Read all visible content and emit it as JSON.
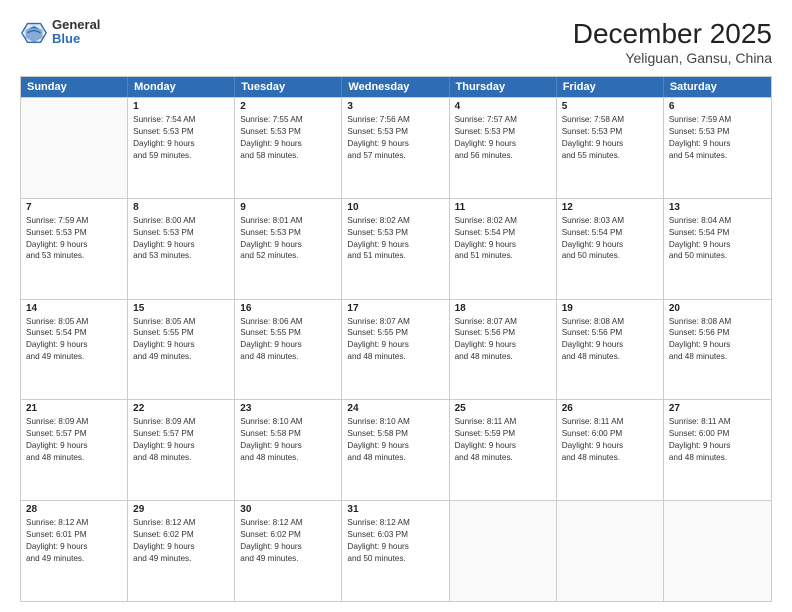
{
  "header": {
    "logo": {
      "general": "General",
      "blue": "Blue"
    },
    "title": "December 2025",
    "location": "Yeliguan, Gansu, China"
  },
  "weekdays": [
    "Sunday",
    "Monday",
    "Tuesday",
    "Wednesday",
    "Thursday",
    "Friday",
    "Saturday"
  ],
  "rows": [
    [
      {
        "day": "",
        "lines": []
      },
      {
        "day": "1",
        "lines": [
          "Sunrise: 7:54 AM",
          "Sunset: 5:53 PM",
          "Daylight: 9 hours",
          "and 59 minutes."
        ]
      },
      {
        "day": "2",
        "lines": [
          "Sunrise: 7:55 AM",
          "Sunset: 5:53 PM",
          "Daylight: 9 hours",
          "and 58 minutes."
        ]
      },
      {
        "day": "3",
        "lines": [
          "Sunrise: 7:56 AM",
          "Sunset: 5:53 PM",
          "Daylight: 9 hours",
          "and 57 minutes."
        ]
      },
      {
        "day": "4",
        "lines": [
          "Sunrise: 7:57 AM",
          "Sunset: 5:53 PM",
          "Daylight: 9 hours",
          "and 56 minutes."
        ]
      },
      {
        "day": "5",
        "lines": [
          "Sunrise: 7:58 AM",
          "Sunset: 5:53 PM",
          "Daylight: 9 hours",
          "and 55 minutes."
        ]
      },
      {
        "day": "6",
        "lines": [
          "Sunrise: 7:59 AM",
          "Sunset: 5:53 PM",
          "Daylight: 9 hours",
          "and 54 minutes."
        ]
      }
    ],
    [
      {
        "day": "7",
        "lines": [
          "Sunrise: 7:59 AM",
          "Sunset: 5:53 PM",
          "Daylight: 9 hours",
          "and 53 minutes."
        ]
      },
      {
        "day": "8",
        "lines": [
          "Sunrise: 8:00 AM",
          "Sunset: 5:53 PM",
          "Daylight: 9 hours",
          "and 53 minutes."
        ]
      },
      {
        "day": "9",
        "lines": [
          "Sunrise: 8:01 AM",
          "Sunset: 5:53 PM",
          "Daylight: 9 hours",
          "and 52 minutes."
        ]
      },
      {
        "day": "10",
        "lines": [
          "Sunrise: 8:02 AM",
          "Sunset: 5:53 PM",
          "Daylight: 9 hours",
          "and 51 minutes."
        ]
      },
      {
        "day": "11",
        "lines": [
          "Sunrise: 8:02 AM",
          "Sunset: 5:54 PM",
          "Daylight: 9 hours",
          "and 51 minutes."
        ]
      },
      {
        "day": "12",
        "lines": [
          "Sunrise: 8:03 AM",
          "Sunset: 5:54 PM",
          "Daylight: 9 hours",
          "and 50 minutes."
        ]
      },
      {
        "day": "13",
        "lines": [
          "Sunrise: 8:04 AM",
          "Sunset: 5:54 PM",
          "Daylight: 9 hours",
          "and 50 minutes."
        ]
      }
    ],
    [
      {
        "day": "14",
        "lines": [
          "Sunrise: 8:05 AM",
          "Sunset: 5:54 PM",
          "Daylight: 9 hours",
          "and 49 minutes."
        ]
      },
      {
        "day": "15",
        "lines": [
          "Sunrise: 8:05 AM",
          "Sunset: 5:55 PM",
          "Daylight: 9 hours",
          "and 49 minutes."
        ]
      },
      {
        "day": "16",
        "lines": [
          "Sunrise: 8:06 AM",
          "Sunset: 5:55 PM",
          "Daylight: 9 hours",
          "and 48 minutes."
        ]
      },
      {
        "day": "17",
        "lines": [
          "Sunrise: 8:07 AM",
          "Sunset: 5:55 PM",
          "Daylight: 9 hours",
          "and 48 minutes."
        ]
      },
      {
        "day": "18",
        "lines": [
          "Sunrise: 8:07 AM",
          "Sunset: 5:56 PM",
          "Daylight: 9 hours",
          "and 48 minutes."
        ]
      },
      {
        "day": "19",
        "lines": [
          "Sunrise: 8:08 AM",
          "Sunset: 5:56 PM",
          "Daylight: 9 hours",
          "and 48 minutes."
        ]
      },
      {
        "day": "20",
        "lines": [
          "Sunrise: 8:08 AM",
          "Sunset: 5:56 PM",
          "Daylight: 9 hours",
          "and 48 minutes."
        ]
      }
    ],
    [
      {
        "day": "21",
        "lines": [
          "Sunrise: 8:09 AM",
          "Sunset: 5:57 PM",
          "Daylight: 9 hours",
          "and 48 minutes."
        ]
      },
      {
        "day": "22",
        "lines": [
          "Sunrise: 8:09 AM",
          "Sunset: 5:57 PM",
          "Daylight: 9 hours",
          "and 48 minutes."
        ]
      },
      {
        "day": "23",
        "lines": [
          "Sunrise: 8:10 AM",
          "Sunset: 5:58 PM",
          "Daylight: 9 hours",
          "and 48 minutes."
        ]
      },
      {
        "day": "24",
        "lines": [
          "Sunrise: 8:10 AM",
          "Sunset: 5:58 PM",
          "Daylight: 9 hours",
          "and 48 minutes."
        ]
      },
      {
        "day": "25",
        "lines": [
          "Sunrise: 8:11 AM",
          "Sunset: 5:59 PM",
          "Daylight: 9 hours",
          "and 48 minutes."
        ]
      },
      {
        "day": "26",
        "lines": [
          "Sunrise: 8:11 AM",
          "Sunset: 6:00 PM",
          "Daylight: 9 hours",
          "and 48 minutes."
        ]
      },
      {
        "day": "27",
        "lines": [
          "Sunrise: 8:11 AM",
          "Sunset: 6:00 PM",
          "Daylight: 9 hours",
          "and 48 minutes."
        ]
      }
    ],
    [
      {
        "day": "28",
        "lines": [
          "Sunrise: 8:12 AM",
          "Sunset: 6:01 PM",
          "Daylight: 9 hours",
          "and 49 minutes."
        ]
      },
      {
        "day": "29",
        "lines": [
          "Sunrise: 8:12 AM",
          "Sunset: 6:02 PM",
          "Daylight: 9 hours",
          "and 49 minutes."
        ]
      },
      {
        "day": "30",
        "lines": [
          "Sunrise: 8:12 AM",
          "Sunset: 6:02 PM",
          "Daylight: 9 hours",
          "and 49 minutes."
        ]
      },
      {
        "day": "31",
        "lines": [
          "Sunrise: 8:12 AM",
          "Sunset: 6:03 PM",
          "Daylight: 9 hours",
          "and 50 minutes."
        ]
      },
      {
        "day": "",
        "lines": []
      },
      {
        "day": "",
        "lines": []
      },
      {
        "day": "",
        "lines": []
      }
    ]
  ]
}
